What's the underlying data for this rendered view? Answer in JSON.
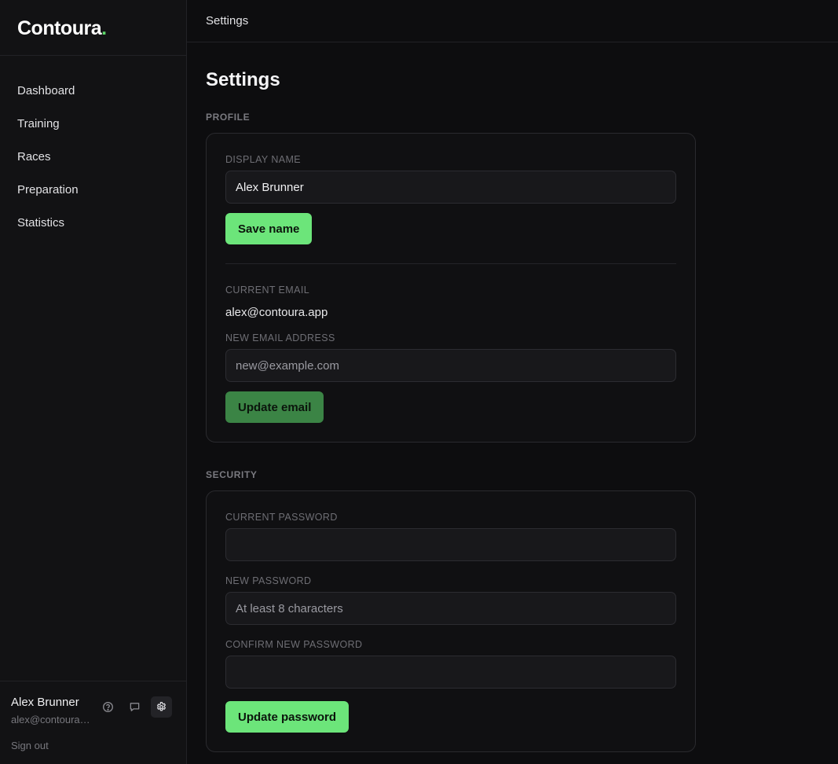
{
  "brand": {
    "name": "Contoura",
    "dot": "."
  },
  "nav": [
    {
      "label": "Dashboard"
    },
    {
      "label": "Training"
    },
    {
      "label": "Races"
    },
    {
      "label": "Preparation"
    },
    {
      "label": "Statistics"
    }
  ],
  "user": {
    "name": "Alex Brunner",
    "email": "alex@contoura.app",
    "sign_out": "Sign out",
    "icons": [
      "help-icon",
      "feedback-icon",
      "settings-icon"
    ]
  },
  "topbar": {
    "title": "Settings"
  },
  "page": {
    "title": "Settings"
  },
  "profile": {
    "section_label": "PROFILE",
    "display_name_label": "DISPLAY NAME",
    "display_name_value": "Alex Brunner",
    "save_name_label": "Save name",
    "current_email_label": "CURRENT EMAIL",
    "current_email_value": "alex@contoura.app",
    "new_email_label": "NEW EMAIL ADDRESS",
    "new_email_placeholder": "new@example.com",
    "update_email_label": "Update email"
  },
  "security": {
    "section_label": "SECURITY",
    "current_password_label": "CURRENT PASSWORD",
    "new_password_label": "NEW PASSWORD",
    "new_password_placeholder": "At least 8 characters",
    "confirm_password_label": "CONFIRM NEW PASSWORD",
    "update_password_label": "Update password"
  },
  "colors": {
    "accent": "#6ce57a",
    "accent_dim": "#3b8445",
    "background": "#0d0d0f",
    "sidebar": "#121214"
  }
}
